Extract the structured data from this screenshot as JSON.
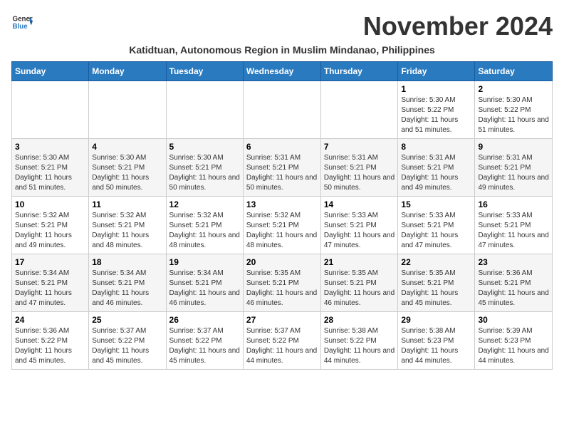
{
  "header": {
    "logo_line1": "General",
    "logo_line2": "Blue",
    "month_title": "November 2024",
    "subtitle": "Katidtuan, Autonomous Region in Muslim Mindanao, Philippines"
  },
  "days_of_week": [
    "Sunday",
    "Monday",
    "Tuesday",
    "Wednesday",
    "Thursday",
    "Friday",
    "Saturday"
  ],
  "weeks": [
    [
      {
        "day": "",
        "info": ""
      },
      {
        "day": "",
        "info": ""
      },
      {
        "day": "",
        "info": ""
      },
      {
        "day": "",
        "info": ""
      },
      {
        "day": "",
        "info": ""
      },
      {
        "day": "1",
        "info": "Sunrise: 5:30 AM\nSunset: 5:22 PM\nDaylight: 11 hours and 51 minutes."
      },
      {
        "day": "2",
        "info": "Sunrise: 5:30 AM\nSunset: 5:22 PM\nDaylight: 11 hours and 51 minutes."
      }
    ],
    [
      {
        "day": "3",
        "info": "Sunrise: 5:30 AM\nSunset: 5:21 PM\nDaylight: 11 hours and 51 minutes."
      },
      {
        "day": "4",
        "info": "Sunrise: 5:30 AM\nSunset: 5:21 PM\nDaylight: 11 hours and 50 minutes."
      },
      {
        "day": "5",
        "info": "Sunrise: 5:30 AM\nSunset: 5:21 PM\nDaylight: 11 hours and 50 minutes."
      },
      {
        "day": "6",
        "info": "Sunrise: 5:31 AM\nSunset: 5:21 PM\nDaylight: 11 hours and 50 minutes."
      },
      {
        "day": "7",
        "info": "Sunrise: 5:31 AM\nSunset: 5:21 PM\nDaylight: 11 hours and 50 minutes."
      },
      {
        "day": "8",
        "info": "Sunrise: 5:31 AM\nSunset: 5:21 PM\nDaylight: 11 hours and 49 minutes."
      },
      {
        "day": "9",
        "info": "Sunrise: 5:31 AM\nSunset: 5:21 PM\nDaylight: 11 hours and 49 minutes."
      }
    ],
    [
      {
        "day": "10",
        "info": "Sunrise: 5:32 AM\nSunset: 5:21 PM\nDaylight: 11 hours and 49 minutes."
      },
      {
        "day": "11",
        "info": "Sunrise: 5:32 AM\nSunset: 5:21 PM\nDaylight: 11 hours and 48 minutes."
      },
      {
        "day": "12",
        "info": "Sunrise: 5:32 AM\nSunset: 5:21 PM\nDaylight: 11 hours and 48 minutes."
      },
      {
        "day": "13",
        "info": "Sunrise: 5:32 AM\nSunset: 5:21 PM\nDaylight: 11 hours and 48 minutes."
      },
      {
        "day": "14",
        "info": "Sunrise: 5:33 AM\nSunset: 5:21 PM\nDaylight: 11 hours and 47 minutes."
      },
      {
        "day": "15",
        "info": "Sunrise: 5:33 AM\nSunset: 5:21 PM\nDaylight: 11 hours and 47 minutes."
      },
      {
        "day": "16",
        "info": "Sunrise: 5:33 AM\nSunset: 5:21 PM\nDaylight: 11 hours and 47 minutes."
      }
    ],
    [
      {
        "day": "17",
        "info": "Sunrise: 5:34 AM\nSunset: 5:21 PM\nDaylight: 11 hours and 47 minutes."
      },
      {
        "day": "18",
        "info": "Sunrise: 5:34 AM\nSunset: 5:21 PM\nDaylight: 11 hours and 46 minutes."
      },
      {
        "day": "19",
        "info": "Sunrise: 5:34 AM\nSunset: 5:21 PM\nDaylight: 11 hours and 46 minutes."
      },
      {
        "day": "20",
        "info": "Sunrise: 5:35 AM\nSunset: 5:21 PM\nDaylight: 11 hours and 46 minutes."
      },
      {
        "day": "21",
        "info": "Sunrise: 5:35 AM\nSunset: 5:21 PM\nDaylight: 11 hours and 46 minutes."
      },
      {
        "day": "22",
        "info": "Sunrise: 5:35 AM\nSunset: 5:21 PM\nDaylight: 11 hours and 45 minutes."
      },
      {
        "day": "23",
        "info": "Sunrise: 5:36 AM\nSunset: 5:21 PM\nDaylight: 11 hours and 45 minutes."
      }
    ],
    [
      {
        "day": "24",
        "info": "Sunrise: 5:36 AM\nSunset: 5:22 PM\nDaylight: 11 hours and 45 minutes."
      },
      {
        "day": "25",
        "info": "Sunrise: 5:37 AM\nSunset: 5:22 PM\nDaylight: 11 hours and 45 minutes."
      },
      {
        "day": "26",
        "info": "Sunrise: 5:37 AM\nSunset: 5:22 PM\nDaylight: 11 hours and 45 minutes."
      },
      {
        "day": "27",
        "info": "Sunrise: 5:37 AM\nSunset: 5:22 PM\nDaylight: 11 hours and 44 minutes."
      },
      {
        "day": "28",
        "info": "Sunrise: 5:38 AM\nSunset: 5:22 PM\nDaylight: 11 hours and 44 minutes."
      },
      {
        "day": "29",
        "info": "Sunrise: 5:38 AM\nSunset: 5:23 PM\nDaylight: 11 hours and 44 minutes."
      },
      {
        "day": "30",
        "info": "Sunrise: 5:39 AM\nSunset: 5:23 PM\nDaylight: 11 hours and 44 minutes."
      }
    ]
  ]
}
